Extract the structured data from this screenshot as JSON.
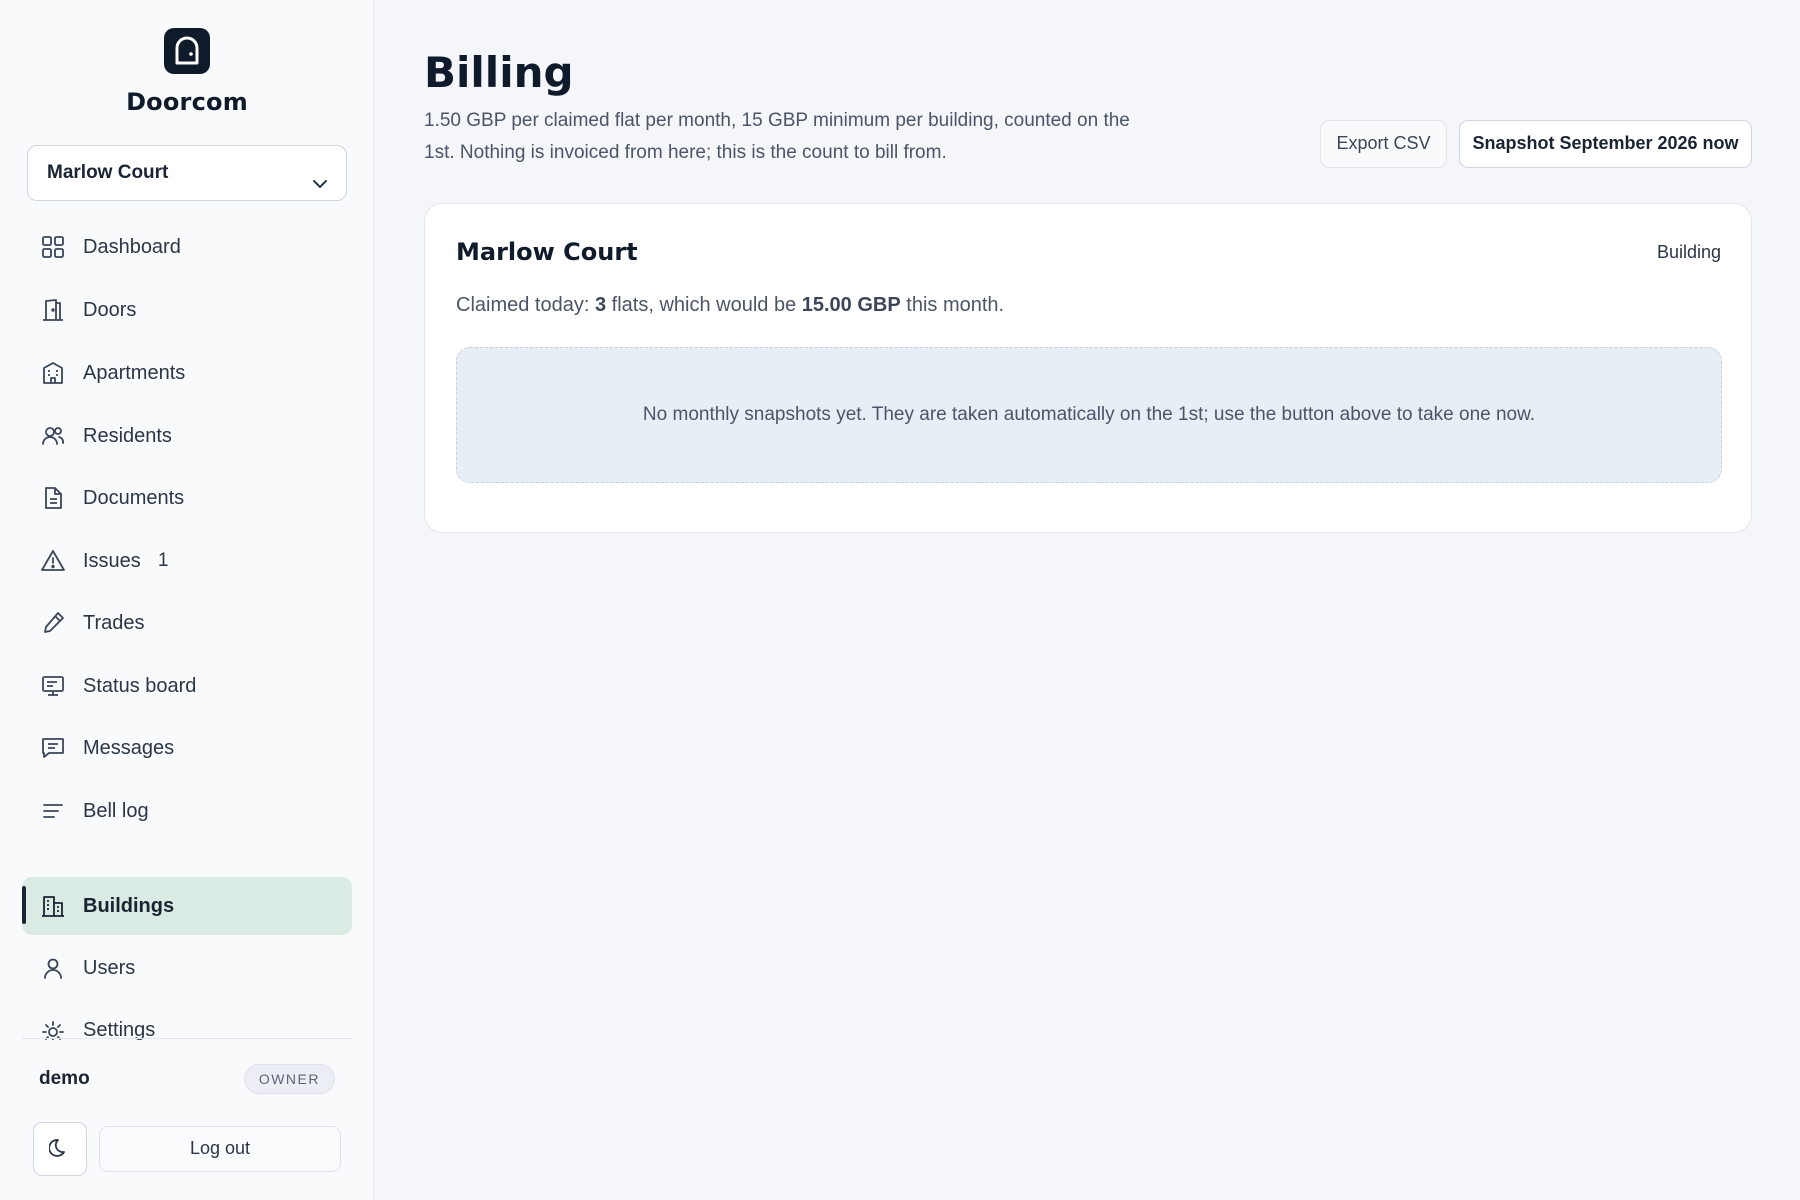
{
  "brand": {
    "name": "Doorcom",
    "logo_icon": "door-bell-icon"
  },
  "building_selector": {
    "value": "Marlow Court"
  },
  "nav": {
    "items": [
      {
        "label": "Dashboard",
        "icon": "grid-icon"
      },
      {
        "label": "Doors",
        "icon": "door-icon"
      },
      {
        "label": "Apartments",
        "icon": "apartment-icon"
      },
      {
        "label": "Residents",
        "icon": "users-icon"
      },
      {
        "label": "Documents",
        "icon": "document-icon"
      },
      {
        "label": "Issues",
        "icon": "warning-icon",
        "badge": "1"
      },
      {
        "label": "Trades",
        "icon": "wrench-icon"
      },
      {
        "label": "Status board",
        "icon": "monitor-icon"
      },
      {
        "label": "Messages",
        "icon": "message-icon"
      },
      {
        "label": "Bell log",
        "icon": "list-icon"
      }
    ],
    "admin_items": [
      {
        "label": "Buildings",
        "icon": "building-icon",
        "active": true
      },
      {
        "label": "Users",
        "icon": "user-icon"
      },
      {
        "label": "Settings",
        "icon": "sun-gear-icon"
      }
    ]
  },
  "user": {
    "name": "demo",
    "role": "OWNER"
  },
  "footer": {
    "logout_label": "Log out",
    "theme_icon": "moon-icon"
  },
  "page": {
    "title": "Billing",
    "description": "1.50 GBP per claimed flat per month, 15 GBP minimum per building, counted on the 1st. Nothing is invoiced from here; this is the count to bill from.",
    "export_label": "Export CSV",
    "snapshot_label": "Snapshot September 2026 now"
  },
  "card": {
    "title": "Marlow Court",
    "kind": "Building",
    "summary_prefix": "Claimed today: ",
    "flats_count": "3",
    "summary_mid": " flats, which would be ",
    "amount": "15.00 GBP",
    "summary_suffix": " this month.",
    "empty_message": "No monthly snapshots yet. They are taken automatically on the 1st; use the button above to take one now."
  },
  "colors": {
    "active_nav_bg": "#d9ebe2",
    "brand_dark": "#0f1a2a",
    "page_bg": "#f4f6fa"
  }
}
